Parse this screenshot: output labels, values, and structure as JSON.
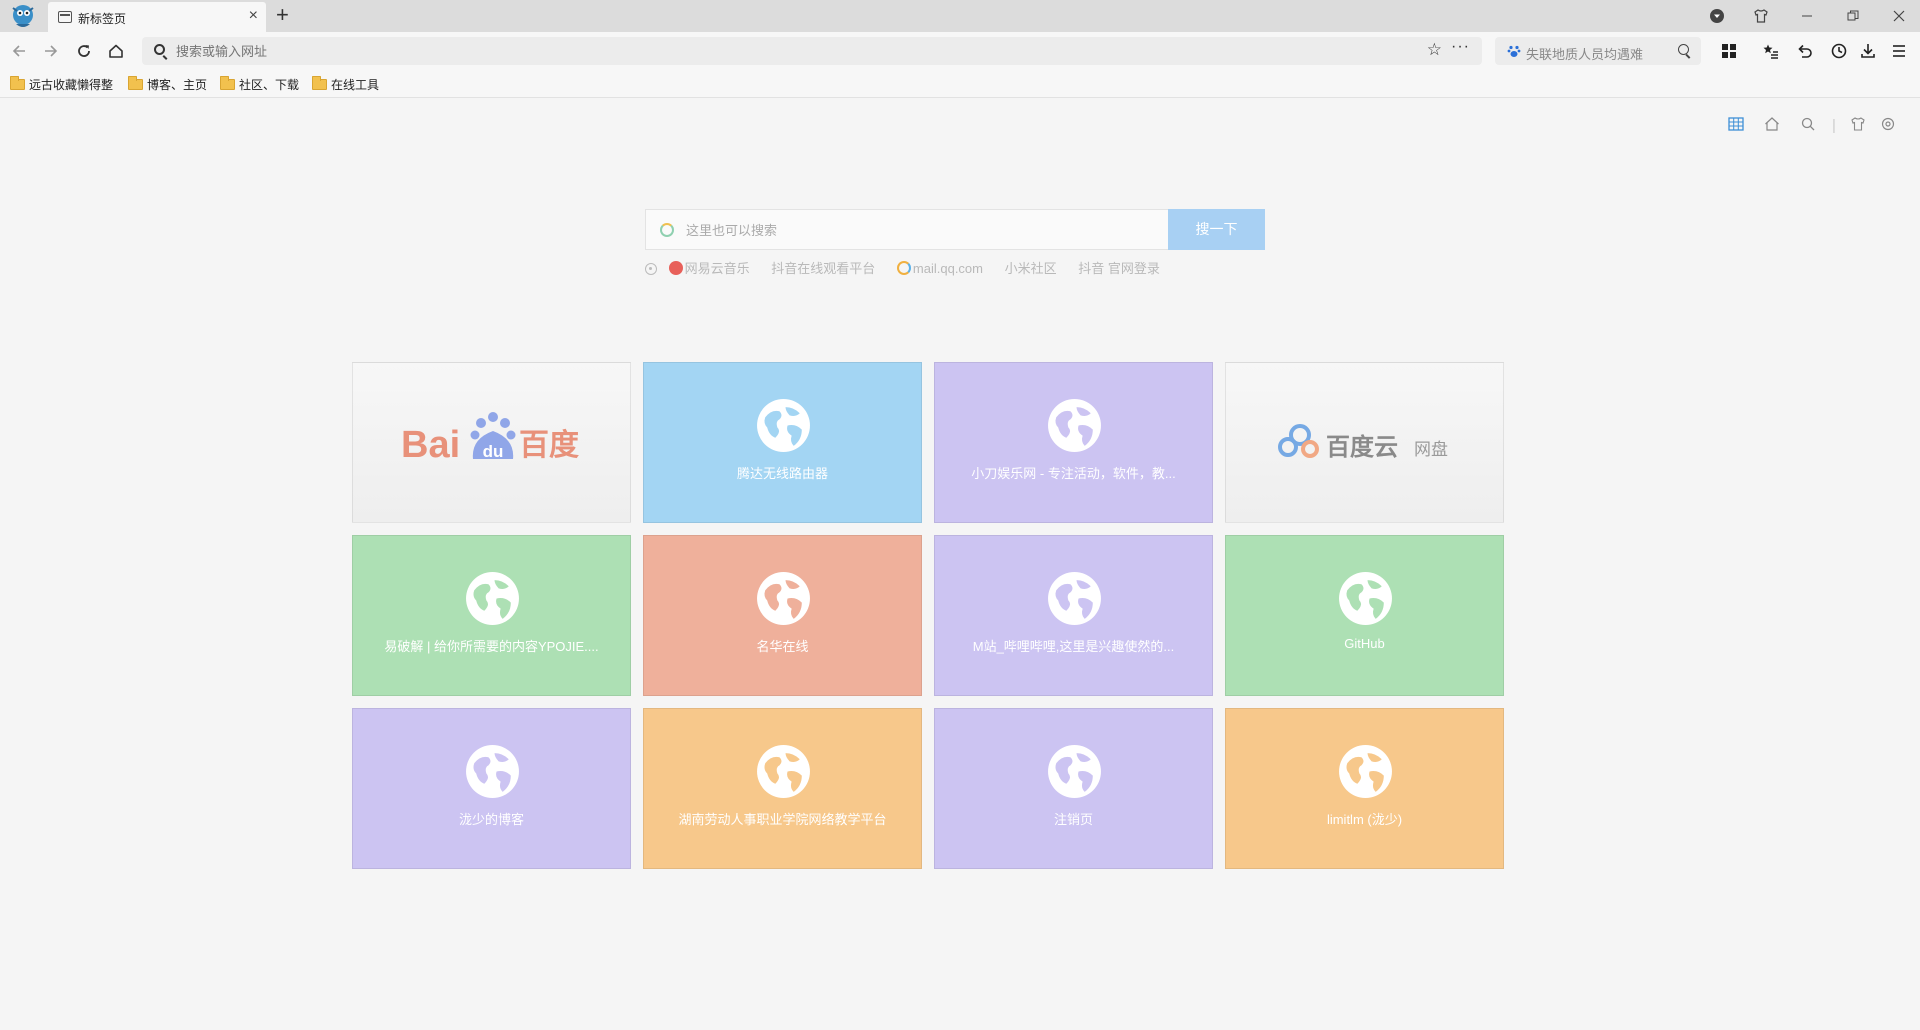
{
  "browser": {
    "tab_title": "新标签页",
    "tab_close": "×",
    "new_tab": "+",
    "address_placeholder": "搜索或输入网址",
    "search_engine_text": "失联地质人员均遇难"
  },
  "bookmarks": [
    "远古收藏懒得整",
    "博客、主页",
    "社区、下载",
    "在线工具"
  ],
  "page": {
    "search_placeholder": "这里也可以搜索",
    "search_button": "搜一下",
    "hot_links": [
      "网易云音乐",
      "抖音在线观看平台",
      "mail.qq.com",
      "小米社区",
      "抖音 官网登录"
    ]
  },
  "tiles": [
    {
      "label": "Baidu百度",
      "kind": "logo",
      "color": "#f0f0f0"
    },
    {
      "label": "腾达无线路由器",
      "kind": "globe",
      "color": "#a3d5f3"
    },
    {
      "label": "小刀娱乐网 - 专注活动，软件，教...",
      "kind": "globe",
      "color": "#ccc4f2"
    },
    {
      "label": "百度云 网盘",
      "kind": "logo",
      "color": "#f0f0f0"
    },
    {
      "label": "易破解 | 给你所需要的内容YPOJIE....",
      "kind": "globe",
      "color": "#ade0b4"
    },
    {
      "label": "名华在线",
      "kind": "globe",
      "color": "#efb09b"
    },
    {
      "label": "M站_哔哩哔哩,这里是兴趣使然的...",
      "kind": "globe",
      "color": "#ccc4f2"
    },
    {
      "label": "GitHub",
      "kind": "globe",
      "color": "#ade0b4"
    },
    {
      "label": "泷少的博客",
      "kind": "globe",
      "color": "#ccc4f2"
    },
    {
      "label": "湖南劳动人事职业学院网络教学平台",
      "kind": "globe",
      "color": "#f7c88b"
    },
    {
      "label": "注销页",
      "kind": "globe",
      "color": "#ccc4f2"
    },
    {
      "label": "limitlm (泷少)",
      "kind": "globe",
      "color": "#f7c88b"
    }
  ],
  "logos": {
    "baidu_text": "Bai",
    "baidu_du": "du",
    "baidu_cn": "百度",
    "baiduyun_cn": "百度云",
    "baiduyun_sub": "网盘"
  },
  "accent_colors": {
    "baidu_red": "#e8917a",
    "baidu_blue": "#90a6e8",
    "yun_blue": "#76a9e4",
    "yun_orange": "#f1a884"
  }
}
